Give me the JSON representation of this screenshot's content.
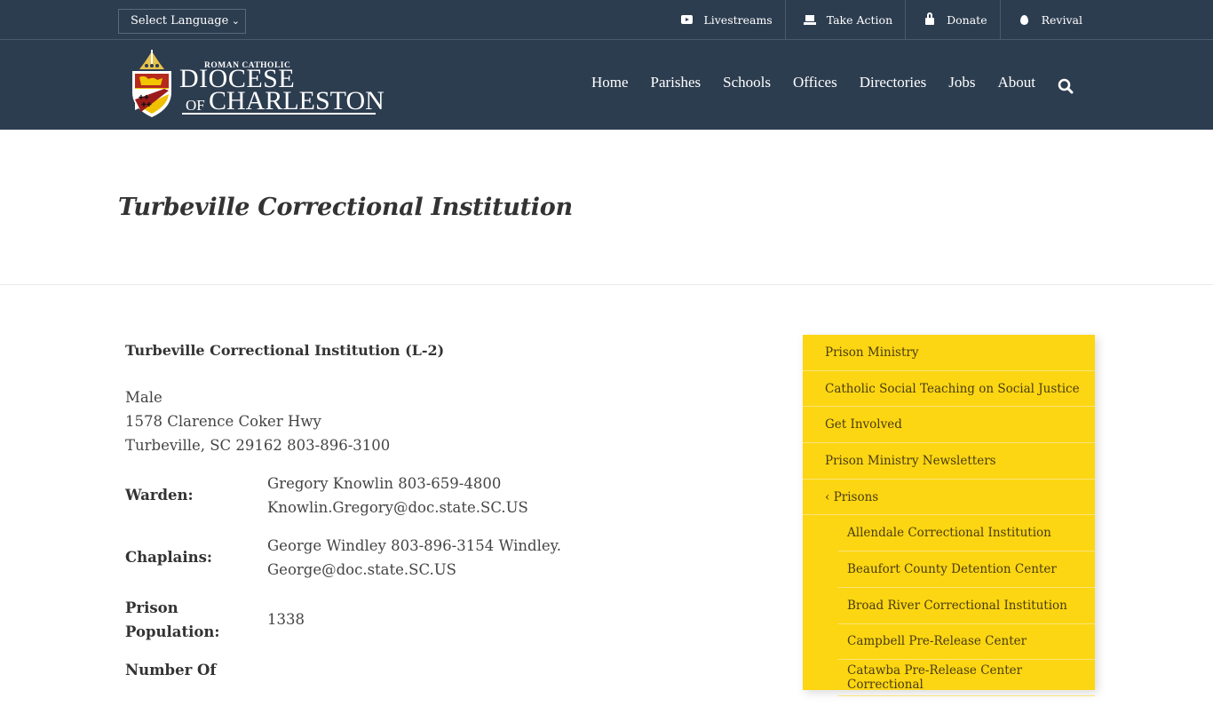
{
  "topbar": {
    "language_select": "Select Language",
    "links": [
      {
        "label": "Livestreams",
        "icon": "youtube-icon"
      },
      {
        "label": "Take Action",
        "icon": "ballot-icon"
      },
      {
        "label": "Donate",
        "icon": "lock-icon"
      },
      {
        "label": "Revival",
        "icon": "fire-icon"
      }
    ]
  },
  "logo": {
    "small": "ROMAN CATHOLIC",
    "line1": "DIOCESE",
    "of": "OF",
    "line2": "CHARLESTON"
  },
  "nav": {
    "links": [
      "Home",
      "Parishes",
      "Schools",
      "Offices",
      "Directories",
      "Jobs",
      "About"
    ],
    "search_icon": "search-icon"
  },
  "page": {
    "title": "Turbeville Correctional Institution"
  },
  "institution": {
    "name": "Turbeville Correctional Institution (L-2)",
    "address_lines": [
      "Male",
      "1578 Clarence Coker Hwy",
      "Turbeville, SC 29162 803-896-3100"
    ],
    "fields": [
      {
        "label": "Warden:",
        "value_lines": [
          "Gregory Knowlin 803-659-4800",
          "Knowlin.Gregory@doc.state.SC.US"
        ]
      },
      {
        "label": "Chaplains:",
        "value_lines": [
          "George Windley 803-896-3154 Windley.",
          "George@doc.state.SC.US"
        ]
      },
      {
        "label_lines": [
          "Prison",
          "Population:"
        ],
        "value_lines": [
          "1338"
        ]
      },
      {
        "label_lines": [
          "Number Of",
          ""
        ],
        "value_lines": [
          ""
        ]
      }
    ]
  },
  "sidebar": {
    "items": [
      "Prison Ministry",
      "Catholic Social Teaching on Social Justice",
      "Get Involved",
      "Prison Ministry Newsletters",
      "‹ Prisons"
    ],
    "sub_items": [
      "Allendale Correctional Institution",
      "Beaufort County Detention Center",
      "Broad River Correctional Institution",
      "Campbell Pre-Release Center",
      "Catawba Pre-Release Center Correctional"
    ]
  },
  "colors": {
    "header_bg": "#2d3d50",
    "sidebar_bg": "#fcd612"
  }
}
